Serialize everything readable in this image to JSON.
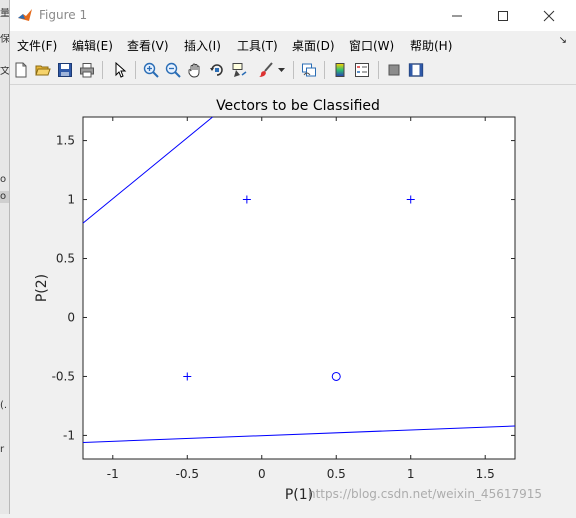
{
  "window": {
    "title": "Figure 1"
  },
  "menu": {
    "items": [
      {
        "label": "文件(F)"
      },
      {
        "label": "编辑(E)"
      },
      {
        "label": "查看(V)"
      },
      {
        "label": "插入(I)"
      },
      {
        "label": "工具(T)"
      },
      {
        "label": "桌面(D)"
      },
      {
        "label": "窗口(W)"
      },
      {
        "label": "帮助(H)"
      }
    ]
  },
  "toolbar": {
    "buttons": [
      "new-figure-icon",
      "open-file-icon",
      "save-icon",
      "print-icon",
      "pointer-icon",
      "zoom-in-icon",
      "zoom-out-icon",
      "pan-icon",
      "rotate-3d-icon",
      "data-cursor-icon",
      "brush-icon",
      "link-plot-icon",
      "colorbar-icon",
      "legend-icon",
      "hide-plot-tools-icon",
      "show-plot-tools-icon"
    ]
  },
  "background_app": {
    "marks": [
      "量",
      "保",
      "文",
      "o",
      "o",
      "(.",
      "r"
    ]
  },
  "chart_data": {
    "type": "scatter",
    "title": "Vectors to be Classified",
    "xlabel": "P(1)",
    "ylabel": "P(2)",
    "xlim": [
      -1.2,
      1.7
    ],
    "ylim": [
      -1.2,
      1.7
    ],
    "xticks": [
      -1,
      -0.5,
      0,
      0.5,
      1,
      1.5
    ],
    "yticks": [
      -1,
      -0.5,
      0,
      0.5,
      1,
      1.5
    ],
    "xticklabels": [
      "-1",
      "-0.5",
      "0",
      "0.5",
      "1",
      "1.5"
    ],
    "yticklabels": [
      "-1",
      "-0.5",
      "0",
      "0.5",
      "1",
      "1.5"
    ],
    "grid": false,
    "series": [
      {
        "marker": "plus",
        "color": "#0000ff",
        "x": [
          -0.1,
          1,
          -0.5
        ],
        "y": [
          1,
          1,
          -0.5
        ]
      },
      {
        "marker": "circle",
        "color": "#0000ff",
        "x": [
          0.5
        ],
        "y": [
          -0.5
        ]
      }
    ],
    "lines": [
      {
        "color": "#0000ff",
        "x": [
          -1.2,
          -0.33
        ],
        "y": [
          0.8,
          1.7
        ]
      },
      {
        "color": "#0000ff",
        "x": [
          -1.2,
          1.7
        ],
        "y": [
          -1.06,
          -0.92
        ]
      }
    ]
  },
  "watermark": "https://blog.csdn.net/weixin_45617915"
}
